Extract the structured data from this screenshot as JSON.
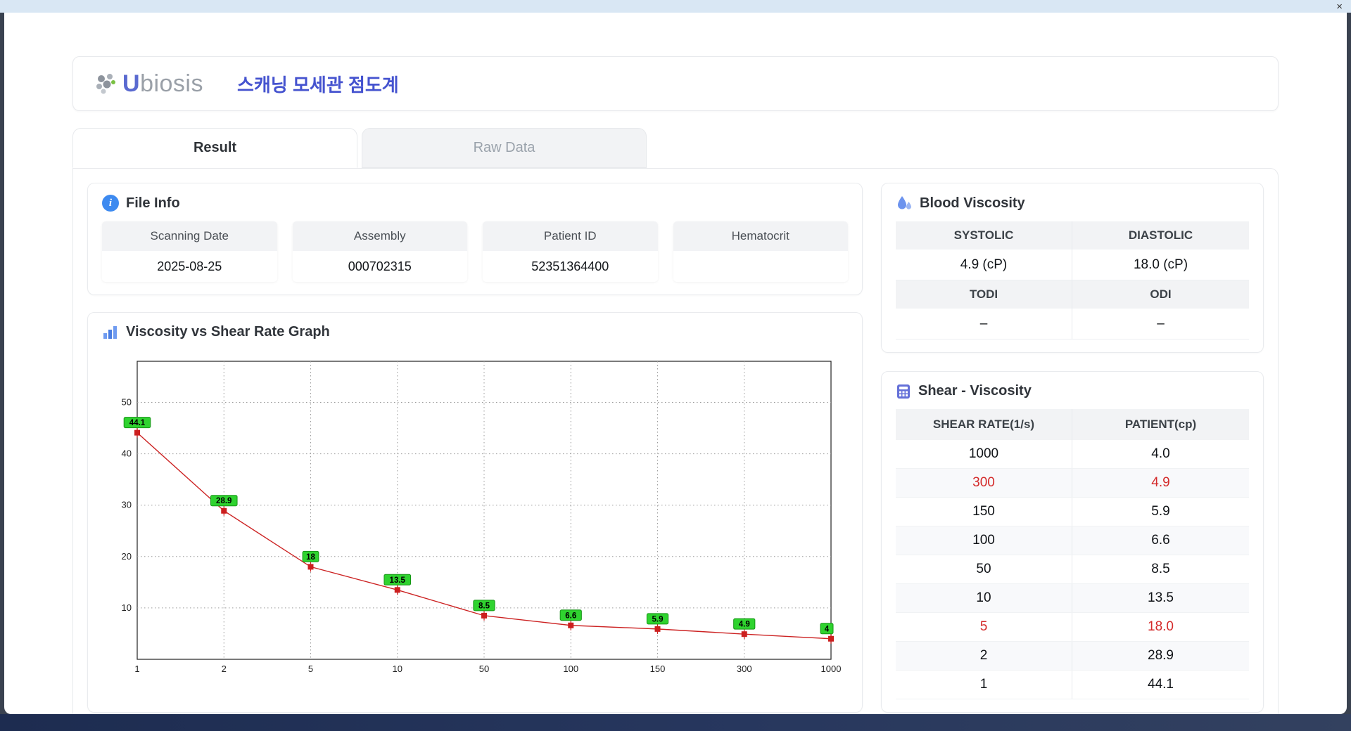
{
  "titlebar": {
    "close_label": "×"
  },
  "header": {
    "brand_u": "U",
    "brand_rest": "biosis",
    "title": "스캐닝 모세관 점도계"
  },
  "tabs": [
    {
      "label": "Result",
      "active": true
    },
    {
      "label": "Raw Data",
      "active": false
    }
  ],
  "file_info": {
    "title": "File Info",
    "fields": [
      {
        "label": "Scanning Date",
        "value": "2025-08-25"
      },
      {
        "label": "Assembly",
        "value": "000702315"
      },
      {
        "label": "Patient ID",
        "value": "52351364400"
      },
      {
        "label": "Hematocrit",
        "value": ""
      }
    ]
  },
  "graph": {
    "title": "Viscosity vs Shear Rate Graph"
  },
  "chart_data": {
    "type": "line",
    "title": "Viscosity vs Shear Rate Graph",
    "x_labels": [
      "1",
      "2",
      "5",
      "10",
      "50",
      "100",
      "150",
      "300",
      "1000"
    ],
    "values": [
      44.1,
      28.9,
      18,
      13.5,
      8.5,
      6.6,
      5.9,
      4.9,
      4
    ],
    "point_labels": [
      "44.1",
      "28.9",
      "18",
      "13.5",
      "8.5",
      "6.6",
      "5.9",
      "4.9",
      "4"
    ],
    "ylim": [
      0,
      58
    ],
    "yticks": [
      10,
      20,
      30,
      40,
      50
    ],
    "grid": "dotted",
    "line_color": "#cc2222",
    "marker_color": "#cc1f1f",
    "label_bg": "#2fd32f",
    "label_border": "#169416"
  },
  "blood_viscosity": {
    "title": "Blood Viscosity",
    "rows": [
      {
        "h1": "SYSTOLIC",
        "h2": "DIASTOLIC",
        "v1": "4.9 (cP)",
        "v2": "18.0 (cP)"
      },
      {
        "h1": "TODI",
        "h2": "ODI",
        "v1": "–",
        "v2": "–"
      }
    ]
  },
  "shear_table": {
    "title": "Shear - Viscosity",
    "columns": [
      "SHEAR RATE(1/s)",
      "PATIENT(cp)"
    ],
    "rows": [
      {
        "rate": "1000",
        "patient": "4.0",
        "highlight": false
      },
      {
        "rate": "300",
        "patient": "4.9",
        "highlight": true
      },
      {
        "rate": "150",
        "patient": "5.9",
        "highlight": false
      },
      {
        "rate": "100",
        "patient": "6.6",
        "highlight": false
      },
      {
        "rate": "50",
        "patient": "8.5",
        "highlight": false
      },
      {
        "rate": "10",
        "patient": "13.5",
        "highlight": false
      },
      {
        "rate": "5",
        "patient": "18.0",
        "highlight": true
      },
      {
        "rate": "2",
        "patient": "28.9",
        "highlight": false
      },
      {
        "rate": "1",
        "patient": "44.1",
        "highlight": false
      }
    ]
  }
}
